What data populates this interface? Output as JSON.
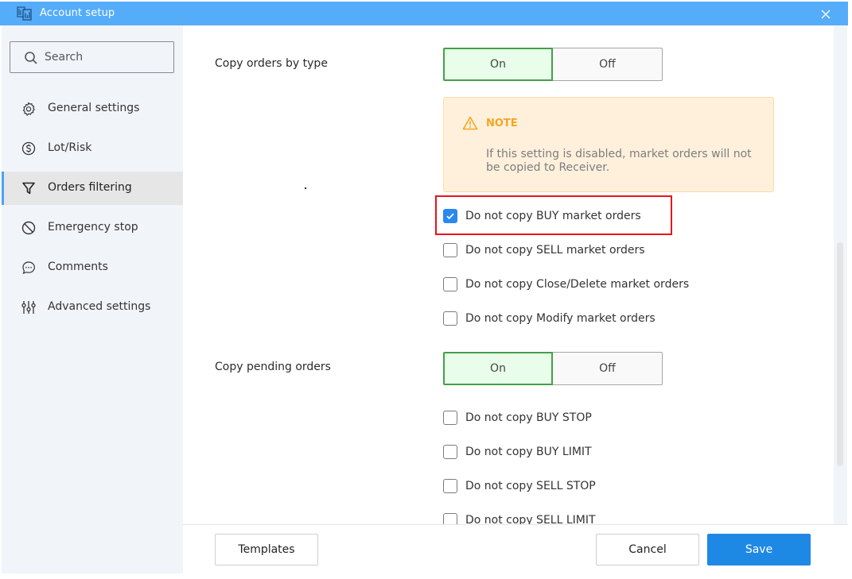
{
  "window": {
    "title": "Account setup",
    "app_icon": "copy-documents-icon",
    "close_icon": "close-icon"
  },
  "sidebar": {
    "search": {
      "placeholder": "Search",
      "icon": "search-icon"
    },
    "items": [
      {
        "label": "General settings",
        "icon": "gear-icon",
        "active": false
      },
      {
        "label": "Lot/Risk",
        "icon": "dollar-circle-icon",
        "active": false
      },
      {
        "label": "Orders filtering",
        "icon": "filter-icon",
        "active": true
      },
      {
        "label": "Emergency stop",
        "icon": "prohibited-icon",
        "active": false
      },
      {
        "label": "Comments",
        "icon": "chat-bubble-icon",
        "active": false
      },
      {
        "label": "Advanced settings",
        "icon": "sliders-icon",
        "active": false
      }
    ]
  },
  "main": {
    "copy_by_type": {
      "label": "Copy orders by type",
      "on_label": "On",
      "off_label": "Off",
      "selected": "On"
    },
    "note": {
      "icon": "warning-icon",
      "title": "NOTE",
      "text": "If this setting is disabled, market orders will not be copied to Receiver."
    },
    "market_checkboxes": [
      {
        "label": "Do not copy BUY market orders",
        "checked": true,
        "highlighted": true
      },
      {
        "label": "Do not copy SELL market orders",
        "checked": false
      },
      {
        "label": "Do not copy Close/Delete market orders",
        "checked": false
      },
      {
        "label": "Do not copy Modify market orders",
        "checked": false
      }
    ],
    "copy_pending": {
      "label": "Copy pending orders",
      "on_label": "On",
      "off_label": "Off",
      "selected": "On"
    },
    "pending_checkboxes": [
      {
        "label": "Do not copy BUY STOP",
        "checked": false
      },
      {
        "label": "Do not copy BUY LIMIT",
        "checked": false
      },
      {
        "label": "Do not copy SELL STOP",
        "checked": false
      },
      {
        "label": "Do not copy SELL LIMIT",
        "checked": false
      }
    ]
  },
  "footer": {
    "templates_label": "Templates",
    "cancel_label": "Cancel",
    "save_label": "Save"
  },
  "colors": {
    "titlebar": "#55acf9",
    "primary": "#1e88e5",
    "toggle_on_bg": "#e8fdea",
    "toggle_on_border": "#43a047",
    "note_bg": "#fff0dc",
    "note_accent": "#f5a623",
    "highlight": "#e8141a"
  }
}
